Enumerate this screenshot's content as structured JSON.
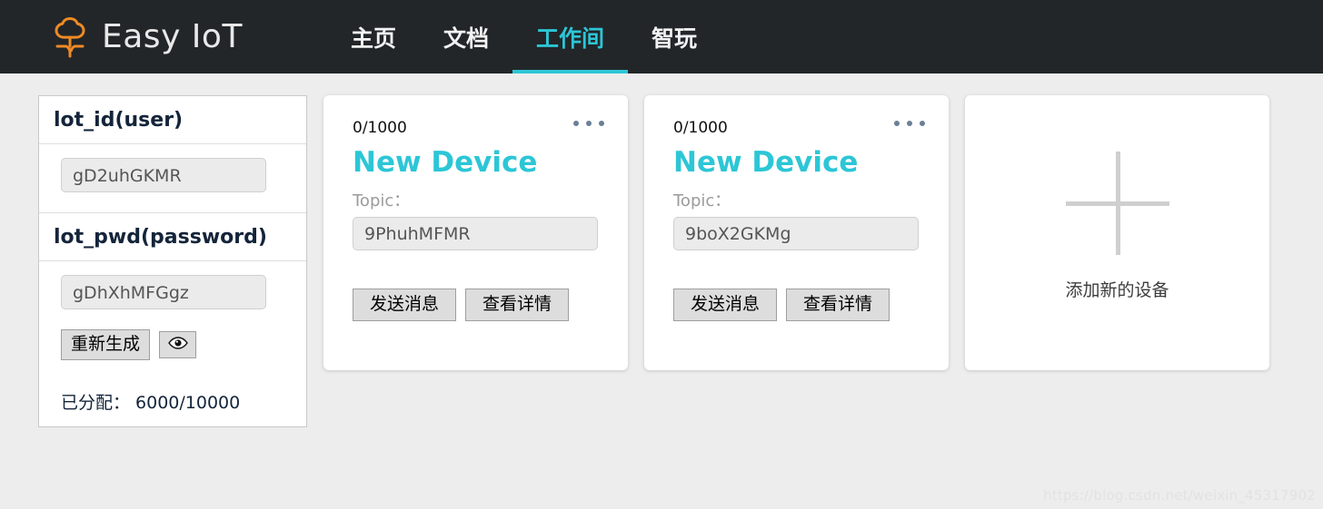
{
  "header": {
    "brand": {
      "name": "Easy IoT",
      "logo_icon": "tree-cloud-logo-icon",
      "logo_color": "#f08a24"
    },
    "nav": [
      {
        "label": "主页",
        "active": false
      },
      {
        "label": "文档",
        "active": false
      },
      {
        "label": "工作间",
        "active": true
      },
      {
        "label": "智玩",
        "active": false
      }
    ],
    "bg_color": "#222629",
    "active_color": "#2cc6d6"
  },
  "credentials": {
    "id_section": {
      "title": "lot_id(user)",
      "value": "gD2uhGKMR"
    },
    "pwd_section": {
      "title": "lot_pwd(password)",
      "value": "gDhXhMFGgz",
      "regenerate_label": "重新生成",
      "toggle_icon": "eye-icon"
    },
    "allocation": "已分配： 6000/10000"
  },
  "devices": [
    {
      "quota": "0/1000",
      "name": "New Device",
      "topic_label": "Topic：",
      "topic_value": "9PhuhMFMR",
      "send_label": "发送消息",
      "detail_label": "查看详情",
      "menu_icon": "more-horizontal-icon"
    },
    {
      "quota": "0/1000",
      "name": "New Device",
      "topic_label": "Topic：",
      "topic_value": "9boX2GKMg",
      "send_label": "发送消息",
      "detail_label": "查看详情",
      "menu_icon": "more-horizontal-icon"
    }
  ],
  "add_card": {
    "icon": "plus-icon",
    "label": "添加新的设备"
  },
  "watermark": "https://blog.csdn.net/weixin_45317902",
  "theme": {
    "accent": "#2cc6d6",
    "page_bg": "#ededed",
    "card_bg": "#ffffff",
    "field_bg": "#ebebeb"
  }
}
